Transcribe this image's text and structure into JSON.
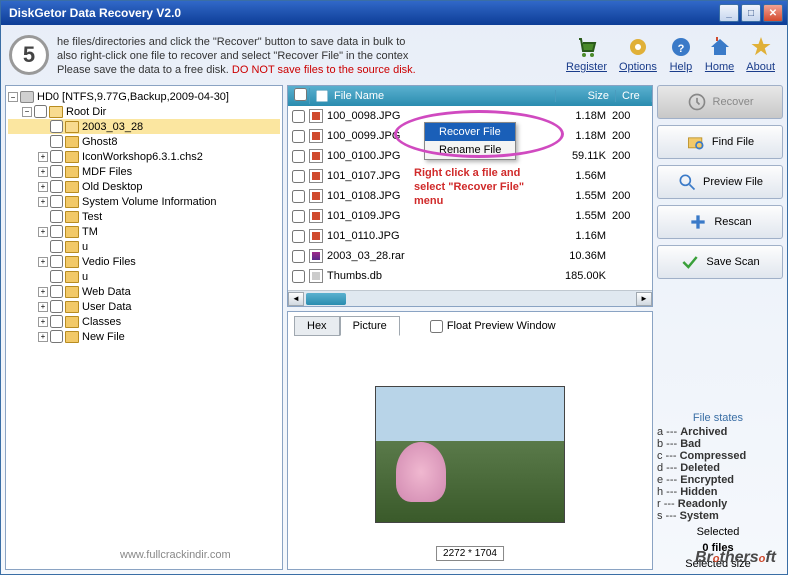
{
  "window": {
    "title": "DiskGetor Data Recovery V2.0"
  },
  "step": "5",
  "instructions": {
    "line1": "he files/directories and click the \"Recover\" button to save data in bulk to",
    "line2": "also right-click one file to recover and select \"Recover File\" in the contex",
    "line3a": "Please save the data to a free disk. ",
    "line3b": "DO NOT save files to the source disk."
  },
  "toolbar": {
    "register": "Register",
    "options": "Options",
    "help": "Help",
    "home": "Home",
    "about": "About"
  },
  "tree": {
    "root": "HD0 [NTFS,9.77G,Backup,2009-04-30]",
    "rootdir": "Root Dir",
    "items": [
      {
        "label": "2003_03_28",
        "selected": true,
        "expand": null
      },
      {
        "label": "Ghost8",
        "expand": null
      },
      {
        "label": "IconWorkshop6.3.1.chs2",
        "expand": "+"
      },
      {
        "label": "MDF Files",
        "expand": "+"
      },
      {
        "label": "Old Desktop",
        "expand": "+"
      },
      {
        "label": "System Volume Information",
        "expand": "+"
      },
      {
        "label": "Test",
        "expand": null
      },
      {
        "label": "TM",
        "expand": "+"
      },
      {
        "label": "u",
        "expand": null
      },
      {
        "label": "Vedio Files",
        "expand": "+"
      },
      {
        "label": "u",
        "expand": null
      },
      {
        "label": "Web Data",
        "expand": "+"
      },
      {
        "label": "User Data",
        "expand": "+"
      },
      {
        "label": "Classes",
        "expand": "+"
      },
      {
        "label": "New File",
        "expand": "+"
      }
    ]
  },
  "filelist": {
    "headers": {
      "chk": "",
      "name": "File Name",
      "size": "Size",
      "cre": "Cre"
    },
    "rows": [
      {
        "name": "100_0098.JPG",
        "size": "1.18M",
        "cre": "200",
        "type": "jpg"
      },
      {
        "name": "100_0099.JPG",
        "size": "1.18M",
        "cre": "200",
        "type": "jpg"
      },
      {
        "name": "100_0100.JPG",
        "size": "59.11K",
        "cre": "200",
        "type": "jpg"
      },
      {
        "name": "101_0107.JPG",
        "size": "1.56M",
        "cre": "",
        "type": "jpg"
      },
      {
        "name": "101_0108.JPG",
        "size": "1.55M",
        "cre": "200",
        "type": "jpg"
      },
      {
        "name": "101_0109.JPG",
        "size": "1.55M",
        "cre": "200",
        "type": "jpg"
      },
      {
        "name": "101_0110.JPG",
        "size": "1.16M",
        "cre": "",
        "type": "jpg"
      },
      {
        "name": "2003_03_28.rar",
        "size": "10.36M",
        "cre": "",
        "type": "rar"
      },
      {
        "name": "Thumbs.db",
        "size": "185.00K",
        "cre": "",
        "type": "db"
      }
    ]
  },
  "context_menu": {
    "recover_file": "Recover File",
    "rename_file": "Rename File"
  },
  "hint": {
    "line1": "Right click a file and",
    "line2": "select \"Recover File\"",
    "line3": "menu"
  },
  "preview": {
    "tab_hex": "Hex",
    "tab_picture": "Picture",
    "float_label": "Float Preview Window",
    "dimensions": "2272 * 1704"
  },
  "actions": {
    "recover": "Recover",
    "find": "Find File",
    "preview": "Preview File",
    "rescan": "Rescan",
    "save": "Save Scan"
  },
  "states": {
    "title": "File states",
    "lines": [
      "a --- Archived",
      "b --- Bad",
      "c --- Compressed",
      "d --- Deleted",
      "e --- Encrypted",
      "h --- Hidden",
      "r --- Readonly",
      "s --- System"
    ],
    "selected_label": "Selected",
    "selected_value": "0 files",
    "size_label": "Selected size"
  },
  "watermark": "www.fullcrackindir.com",
  "brand": "Brothersoft"
}
